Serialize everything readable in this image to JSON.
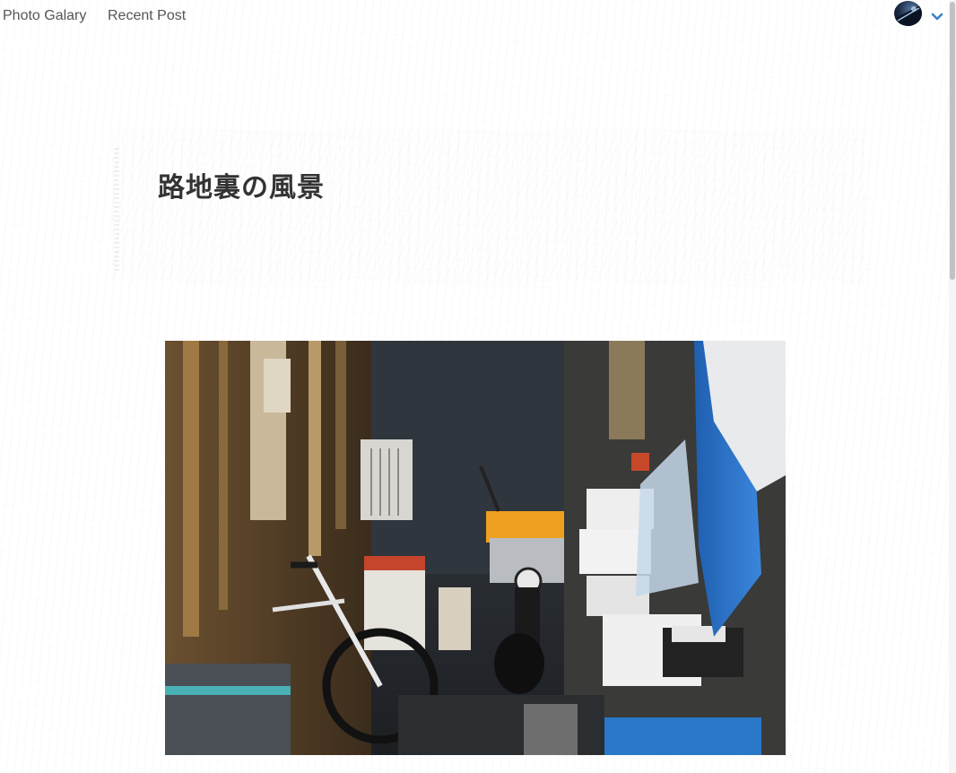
{
  "nav": {
    "photo_gallery_label": "Photo Galary",
    "recent_post_label": "Recent Post"
  },
  "user_menu": {
    "avatar_icon": "avatar-icon",
    "dropdown_icon": "chevron-down-icon",
    "accent_color": "#3b82c4"
  },
  "post": {
    "title": "路地裏の風景",
    "image_alt": "narrow back alley with a bicycle and a parked scooter"
  }
}
